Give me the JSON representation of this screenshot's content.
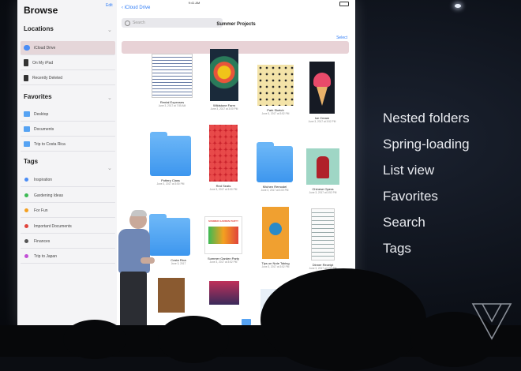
{
  "sidebar": {
    "title": "Browse",
    "edit_label": "Edit",
    "locations_header": "Locations",
    "locations": [
      {
        "label": "iCloud Drive",
        "icon": "cloud-icon"
      },
      {
        "label": "On My iPad",
        "icon": "ipad-icon"
      },
      {
        "label": "Recently Deleted",
        "icon": "trash-icon"
      }
    ],
    "favorites_header": "Favorites",
    "favorites": [
      {
        "label": "Desktop"
      },
      {
        "label": "Documents"
      },
      {
        "label": "Trip to Costa Rica"
      }
    ],
    "tags_header": "Tags",
    "tags": [
      {
        "label": "Inspiration",
        "color": "#4a8df5"
      },
      {
        "label": "Gardening Ideas",
        "color": "#3cba54"
      },
      {
        "label": "For Fun",
        "color": "#f4a020"
      },
      {
        "label": "Important Documents",
        "color": "#e0443c"
      },
      {
        "label": "Finances",
        "color": "#555555"
      },
      {
        "label": "Trip to Japan",
        "color": "#c24fd6"
      }
    ]
  },
  "main": {
    "status_time": "9:41 AM",
    "back_label": "iCloud Drive",
    "title": "Summer Projects",
    "search_placeholder": "Search",
    "select_label": "Select",
    "files": [
      {
        "name": "Rental Expenses",
        "date": "June 3, 2017 at 7:55 AM"
      },
      {
        "name": "Wildstone Farm",
        "date": "June 3, 2017 at 3:00 PM"
      },
      {
        "name": "Park Sketch",
        "date": "June 3, 2017 at 3:52 PM"
      },
      {
        "name": "Ice Cream",
        "date": "June 3, 2017 at 3:52 PM"
      },
      {
        "name": "Pottery Class",
        "date": "June 3, 2017 at 3:50 PM"
      },
      {
        "name": "Red Seats",
        "date": "June 3, 2017 at 3:50 PM"
      },
      {
        "name": "Kitchen Remodel",
        "date": "June 3, 2017 at 3:00 PM"
      },
      {
        "name": "Chinese Opera",
        "date": "June 3, 2017 at 3:52 PM"
      },
      {
        "name": "Costa Rica",
        "date": "June 3, 2017"
      },
      {
        "name": "Summer Garden Party",
        "date": "June 3, 2017 at 3:52 PM"
      },
      {
        "name": "Tips on Note Taking",
        "date": "June 3, 2017 at 3:52 PM"
      },
      {
        "name": "Dinner Receipt",
        "date": "June 3, 2017 at 3:52 PM"
      }
    ],
    "banner_text": "SUMMER GARDEN PARTY"
  },
  "features": [
    "Nested folders",
    "Spring-loading",
    "List view",
    "Favorites",
    "Search",
    "Tags"
  ],
  "colors": {
    "accent": "#2f7cf6",
    "folder": "#56a3f3",
    "selection": "#e5d6d9"
  }
}
